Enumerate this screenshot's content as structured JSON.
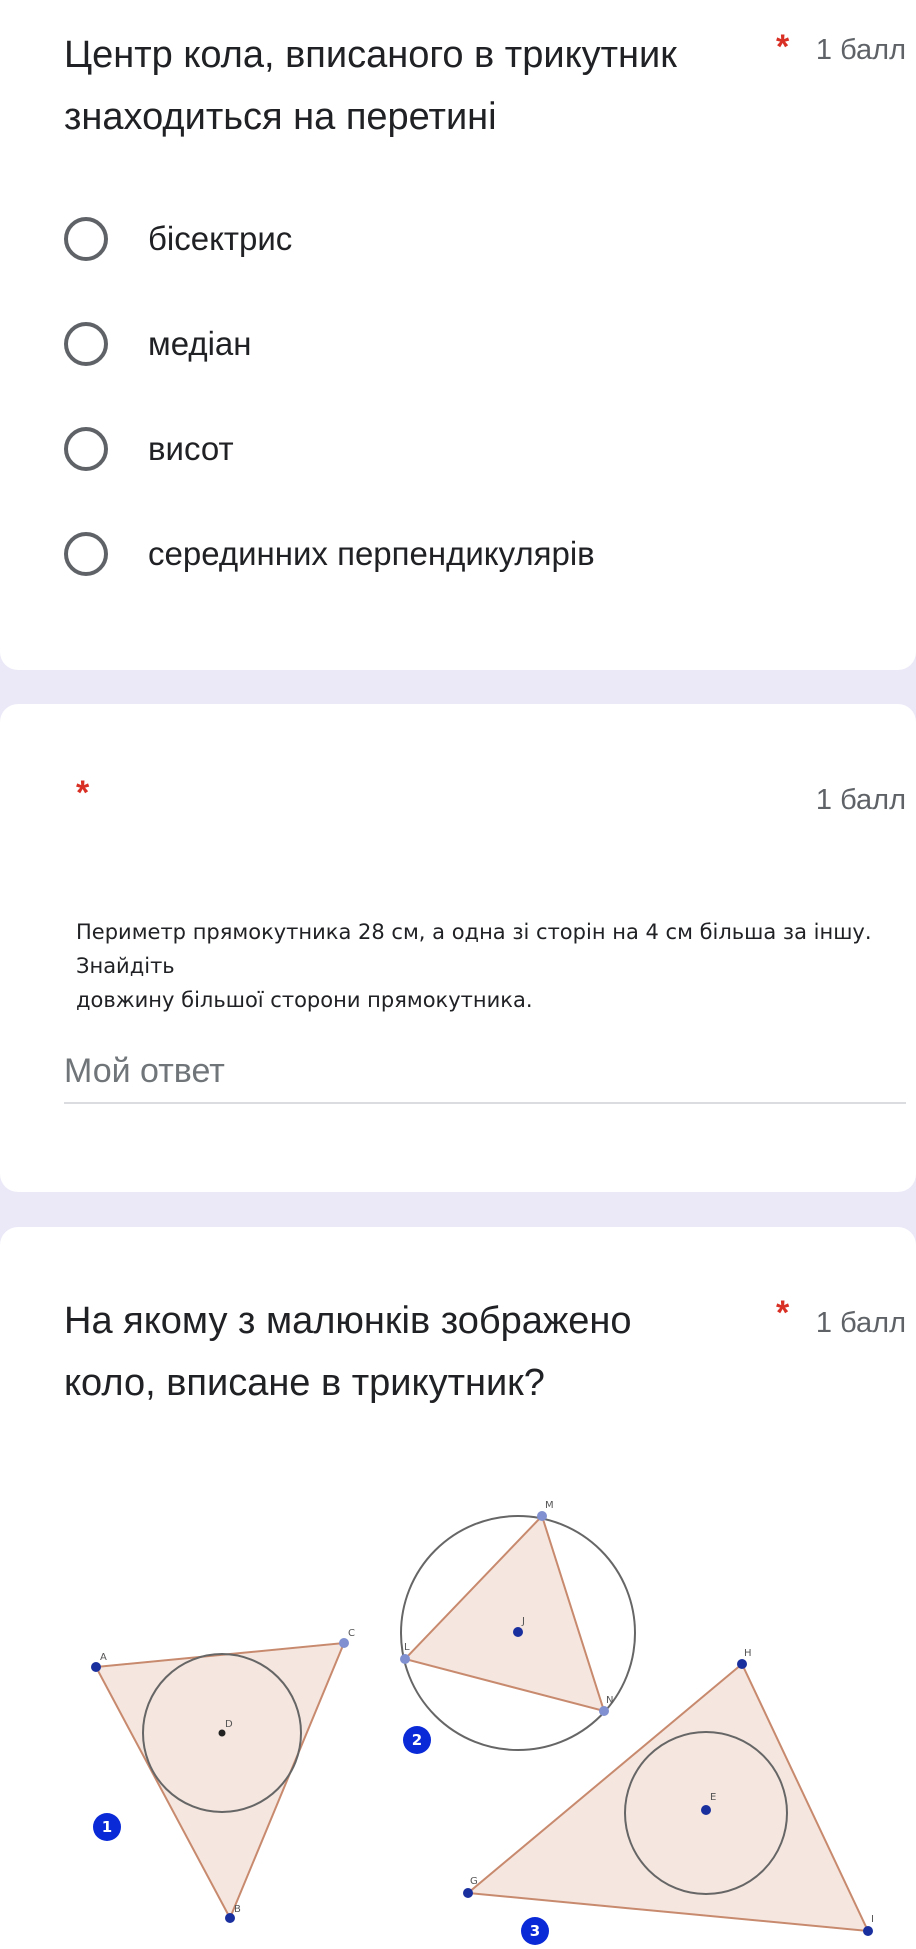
{
  "question1": {
    "title": "Центр кола, вписаного в трикутник знаходиться на перетині",
    "title_line1": "Центр кола, вписаного в трикутник",
    "title_line2": "знаходиться на перетині",
    "required_mark": "*",
    "points": "1 балл",
    "options": [
      {
        "label": "бісектрис"
      },
      {
        "label": "медіан"
      },
      {
        "label": "висот"
      },
      {
        "label": "серединних перпендикулярів"
      }
    ]
  },
  "question2": {
    "required_mark": "*",
    "points": "1 балл",
    "prompt_line1": "Периметр прямокутника 28 см, а одна зі сторін на 4 см більша за іншу. Знайдіть",
    "prompt_line2": "довжину більшої сторони прямокутника.",
    "answer_placeholder": "Мой ответ",
    "answer_value": ""
  },
  "question3": {
    "title_line1": "На якому з малюнків зображено",
    "title_line2": "коло, вписане в трикутник?",
    "required_mark": "*",
    "points": "1 балл",
    "figure": {
      "fig1_points": [
        "A",
        "C",
        "B",
        "D"
      ],
      "fig2_points": [
        "M",
        "L",
        "N",
        "J"
      ],
      "fig3_points": [
        "H",
        "G",
        "I",
        "E"
      ],
      "badges": [
        "1",
        "2",
        "3"
      ],
      "colors": {
        "triangle_fill": "#f5e6df",
        "triangle_stroke": "#c88a6e",
        "circle_stroke": "#666666",
        "badge": "#0a2ad8",
        "vertex": "#1a2f9e"
      }
    }
  }
}
